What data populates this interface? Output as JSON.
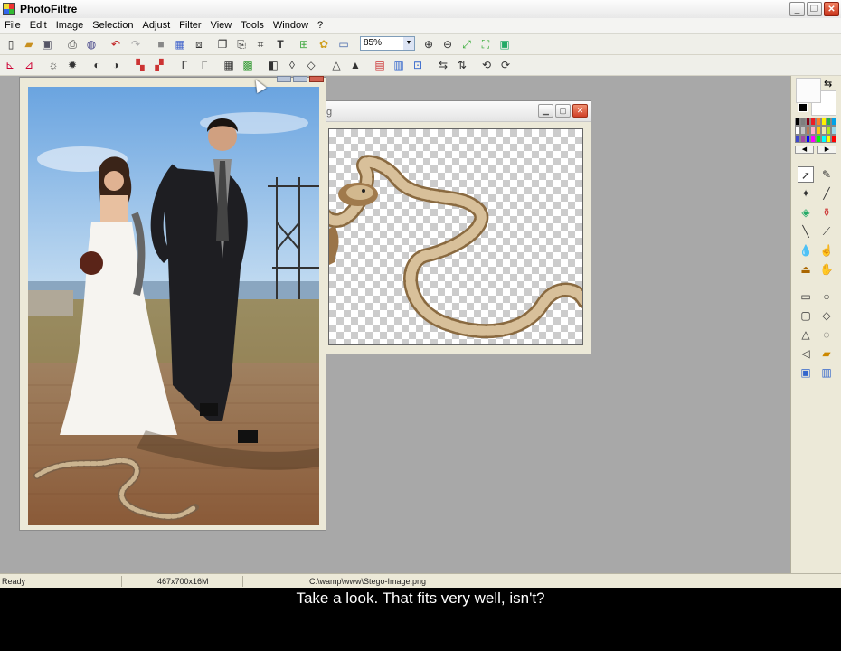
{
  "app": {
    "title": "PhotoFiltre"
  },
  "window_buttons": {
    "minimize": "_",
    "maximize": "❐",
    "close": "✕"
  },
  "menu": [
    "File",
    "Edit",
    "Image",
    "Selection",
    "Adjust",
    "Filter",
    "View",
    "Tools",
    "Window",
    "?"
  ],
  "toolbar": {
    "zoom_value": "85%"
  },
  "doc2": {
    "caption": "g"
  },
  "statusbar": {
    "status": "Ready",
    "dimensions": "467x700x16M",
    "path": "C:\\wamp\\www\\Stego-Image.png"
  },
  "subtitle": "Take a look. That fits very well, isn't?",
  "colors": {
    "titlebar": "#f4f4f2",
    "workspace": "#a8a8a8",
    "close": "#d04028",
    "panel": "#ece9d8"
  },
  "palette": [
    "#000000",
    "#7f7f7f",
    "#880015",
    "#ed1c24",
    "#ff7f27",
    "#fff200",
    "#22b14c",
    "#00a2e8",
    "#ffffff",
    "#c3c3c3",
    "#b97a57",
    "#ffaec9",
    "#ffc90e",
    "#efe4b0",
    "#b5e61d",
    "#99d9ea",
    "#3f48cc",
    "#a349a4",
    "#0000ff",
    "#ff00ff",
    "#00ff00",
    "#00ffff",
    "#ffff00",
    "#ff0000"
  ]
}
